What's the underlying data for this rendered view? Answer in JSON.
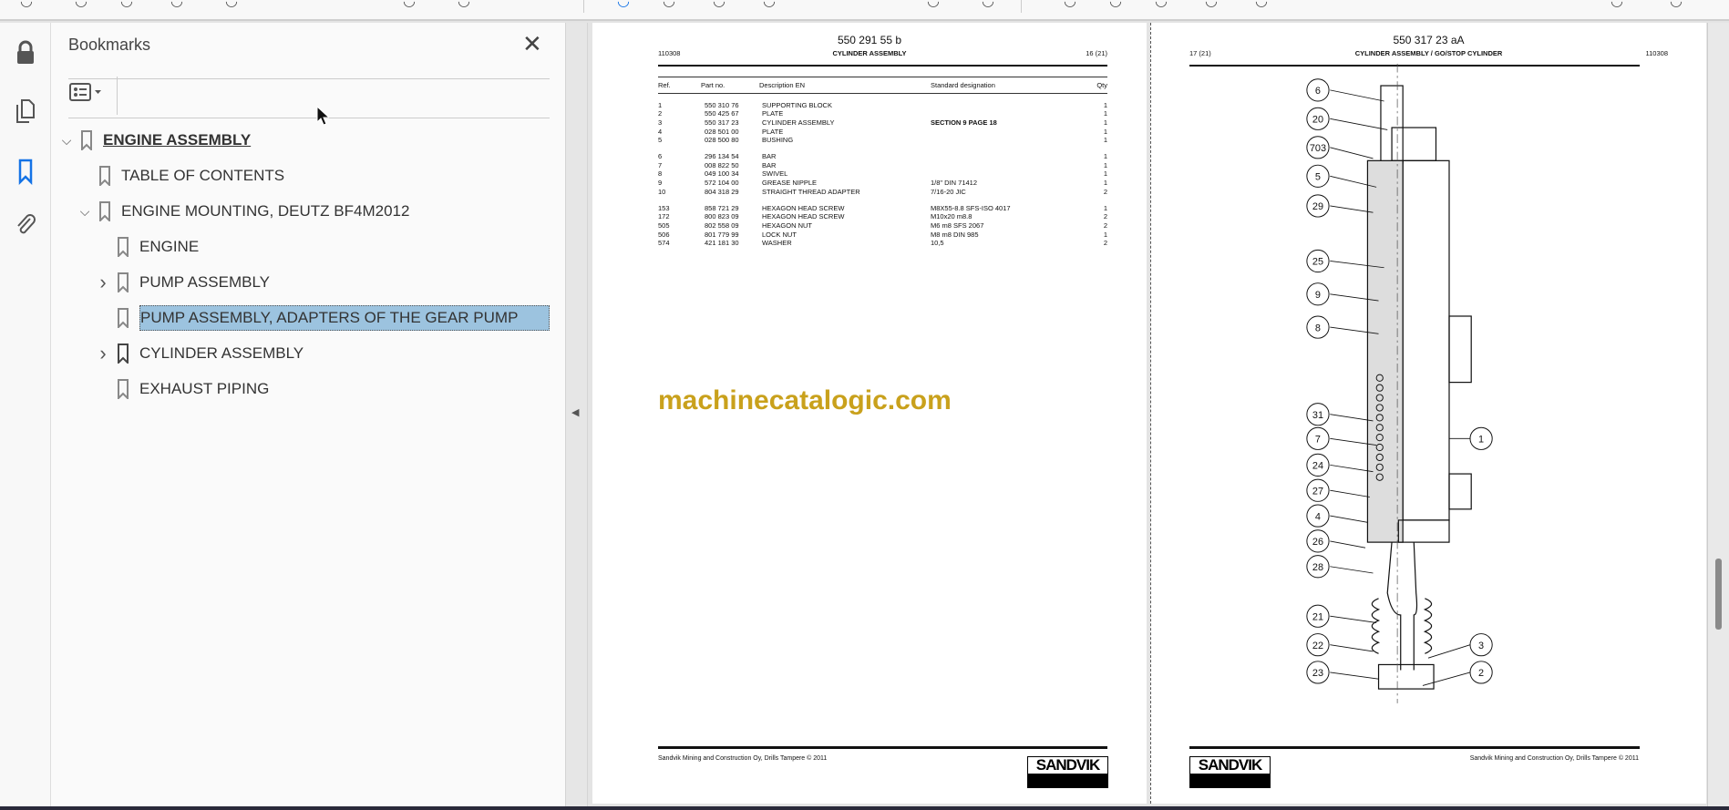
{
  "toolbar": {
    "icons": [
      "save-icon",
      "bookmark-icon",
      "upload-icon",
      "print-icon",
      "search-icon",
      "page-up-icon",
      "page-down-icon",
      "select-icon",
      "hand-icon",
      "zoom-out-icon",
      "zoom-in-icon",
      "fit-icon",
      "scroll-icon",
      "comment-icon",
      "highlight-icon",
      "draw-icon",
      "sign-icon",
      "stamp-icon",
      "share-icon",
      "account-icon"
    ]
  },
  "rail": {
    "icons": [
      "lock-icon",
      "pages-icon",
      "bookmarks-icon",
      "attachment-icon"
    ],
    "accent": "#1473e6"
  },
  "bookmarks": {
    "title": "Bookmarks",
    "close": "✕",
    "items": [
      {
        "label": "ENGINE ASSEMBLY",
        "level": 0,
        "expander": "open",
        "bold": true
      },
      {
        "label": "TABLE OF CONTENTS",
        "level": 1,
        "expander": "none"
      },
      {
        "label": "ENGINE MOUNTING, DEUTZ BF4M2012",
        "level": 1,
        "expander": "open"
      },
      {
        "label": "ENGINE",
        "level": 2,
        "expander": "none"
      },
      {
        "label": "PUMP ASSEMBLY",
        "level": 2,
        "expander": "closed"
      },
      {
        "label": "PUMP ASSEMBLY, ADAPTERS OF THE GEAR PUMP",
        "level": 2,
        "expander": "none",
        "selected": true
      },
      {
        "label": "CYLINDER ASSEMBLY",
        "level": 2,
        "expander": "closed"
      },
      {
        "label": "EXHAUST PIPING",
        "level": 2,
        "expander": "none"
      }
    ]
  },
  "page1": {
    "doc_no": "550 291 55 b",
    "code": "110308",
    "title": "CYLINDER ASSEMBLY",
    "page": "16 (21)",
    "columns": [
      "Ref.",
      "Part no.",
      "Description EN",
      "Standard designation",
      "Qty"
    ],
    "groups": [
      [
        [
          "1",
          "550 310 76",
          "SUPPORTING BLOCK",
          "",
          "1"
        ],
        [
          "2",
          "550 425 67",
          "PLATE",
          "",
          "1"
        ],
        [
          "3",
          "550 317 23",
          "CYLINDER ASSEMBLY",
          "SECTION 9 PAGE 18",
          "1"
        ],
        [
          "4",
          "028 501 00",
          "PLATE",
          "",
          "1"
        ],
        [
          "5",
          "028 500 80",
          "BUSHING",
          "",
          "1"
        ]
      ],
      [
        [
          "6",
          "296 134 54",
          "BAR",
          "",
          "1"
        ],
        [
          "7",
          "008 822 50",
          "BAR",
          "",
          "1"
        ],
        [
          "8",
          "049 100 34",
          "SWIVEL",
          "",
          "1"
        ],
        [
          "9",
          "572 104 00",
          "GREASE NIPPLE",
          "1/8\" DIN 71412",
          "1"
        ],
        [
          "10",
          "804 318 29",
          "STRAIGHT THREAD ADAPTER",
          "7/16-20 JIC",
          "2"
        ]
      ],
      [
        [
          "153",
          "858 721 29",
          "HEXAGON HEAD SCREW",
          "M8X55-8.8 SFS-ISO 4017",
          "1"
        ],
        [
          "172",
          "800 823 09",
          "HEXAGON HEAD SCREW",
          "M10x20 m8.8",
          "2"
        ],
        [
          "505",
          "802 558 09",
          "HEXAGON NUT",
          "M6 m8 SFS 2067",
          "2"
        ],
        [
          "506",
          "801 779 99",
          "LOCK NUT",
          "M8 m8 DIN 985",
          "1"
        ],
        [
          "574",
          "421 181 30",
          "WASHER",
          "10,5",
          "2"
        ]
      ]
    ],
    "watermark": "machinecatalogic.com",
    "footer": "Sandvik Mining and Construction Oy, Drills Tampere © 2011",
    "logo": "SANDVIK"
  },
  "page2": {
    "doc_no": "550 317 23 aA",
    "page": "17 (21)",
    "title": "CYLINDER ASSEMBLY / GO/STOP CYLINDER",
    "code": "110308",
    "callouts_left": [
      "6",
      "20",
      "703",
      "5",
      "29",
      "25",
      "9",
      "8",
      "31",
      "7",
      "24",
      "27",
      "4",
      "26",
      "28",
      "21",
      "22",
      "23"
    ],
    "callouts_right": [
      "1",
      "3",
      "2"
    ],
    "footer": "Sandvik Mining and Construction Oy, Drills Tampere © 2011",
    "logo": "SANDVIK"
  }
}
